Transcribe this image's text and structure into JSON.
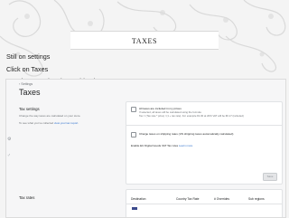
{
  "slide": {
    "title": "TAXES",
    "bullets": [
      "Still on settings",
      "Click on Taxes",
      "You don’t need to do anything here"
    ]
  },
  "screenshot": {
    "back_link": "‹ Settings",
    "page_title": "Taxes",
    "tax_settings": {
      "title": "Tax settings",
      "description": "Change the way taxes are calculated on your store.",
      "hint_prefix": "To see what you’ve collected ",
      "hint_link": "view your tax report",
      "hint_suffix": "."
    },
    "options": {
      "all_included": {
        "label": "All taxes are included in my prices",
        "detail_1": "If selected, all taxes will be calculated using the formula",
        "detail_2": "Tax = (Tax rate * price) / (1 + tax rate). For example €1.00 at 20% VAT will be €0.17 (included)"
      },
      "shipping": {
        "label": "Charge taxes on shipping rates (US shipping taxes automatically calculated)"
      }
    },
    "eu_line": {
      "prefix": "Enable EU Digital Goods VAT Tax rules ",
      "link": "Learn more"
    },
    "save_button": "Save",
    "tax_rates": {
      "title": "Tax rates",
      "columns": [
        "Destination",
        "Country Tax Rate",
        "# Overrides",
        "Sub regions"
      ]
    },
    "icons": [
      "gear-icon",
      "help-icon"
    ]
  }
}
